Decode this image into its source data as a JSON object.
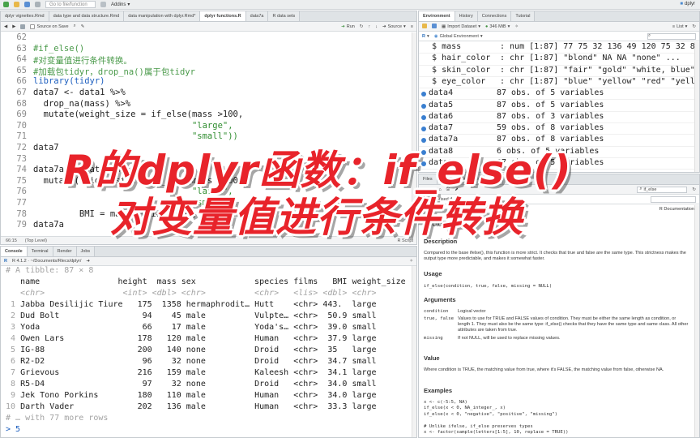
{
  "topbar": {
    "go_to_file": "Go to file/function",
    "addins": "Addins",
    "user": "dplyr"
  },
  "editor": {
    "tabs": [
      {
        "label": "dplyr vignettes.Rmd"
      },
      {
        "label": "data type and data structure.Rmd"
      },
      {
        "label": "data manipulation with dplyr.Rmd*"
      },
      {
        "label": "dplyr functions.R"
      },
      {
        "label": "data7a"
      },
      {
        "label": "R data sets"
      }
    ],
    "toolbar": {
      "source_on_save": "Source on Save",
      "run": "Run",
      "source": "Source"
    },
    "lines": [
      {
        "n": "62",
        "text": ""
      },
      {
        "n": "63",
        "text": "#if_else()",
        "cls": "comment"
      },
      {
        "n": "64",
        "text": "#对变量值进行条件转换。",
        "cls": "comment"
      },
      {
        "n": "65",
        "text": "#加载包tidyr，drop_na()属于包tidyr",
        "cls": "comment"
      },
      {
        "n": "66",
        "text": "library(tidyr)",
        "cls": "keyword"
      },
      {
        "n": "67",
        "text": "data7 <- data1 %>%"
      },
      {
        "n": "68",
        "text": "  drop_na(mass) %>%"
      },
      {
        "n": "69",
        "text": "  mutate(weight_size = if_else(mass >100,"
      },
      {
        "n": "70",
        "text": "                               \"large\",",
        "cls": "str"
      },
      {
        "n": "71",
        "text": "                               \"small\"))",
        "cls": "str"
      },
      {
        "n": "72",
        "text": "data7"
      },
      {
        "n": "73",
        "text": ""
      },
      {
        "n": "74",
        "text": "data7a <- data1 %>%"
      },
      {
        "n": "75",
        "text": "  mutate(weight_size = if_else(mass >100,"
      },
      {
        "n": "76",
        "text": "                               \"large\",",
        "cls": "str"
      },
      {
        "n": "77",
        "text": "                               \"small\"),",
        "cls": "str"
      },
      {
        "n": "78",
        "text": "         BMI = mass/(height/100)^2)"
      },
      {
        "n": "79",
        "text": "data7a"
      }
    ],
    "status_pos": "66:15",
    "status_level": "(Top Level)",
    "status_type": "R Script"
  },
  "console": {
    "tabs": [
      {
        "label": "Console"
      },
      {
        "label": "Terminal"
      },
      {
        "label": "Render"
      },
      {
        "label": "Jobs"
      }
    ],
    "path": "R 4.1.2 · ~/Documents/Rlecs/dplyr/",
    "tibble_header": "# A tibble: 87 × 8",
    "columns": "   name                height  mass sex            species films   BMI weight_size",
    "types": "   <chr>                <int> <dbl> <chr>          <chr>   <lis> <dbl> <chr>",
    "rows": [
      {
        "i": " 1",
        "text": "Jabba Desilijic Tiure   175  1358 hermaphrodit… Hutt    <chr> 443.  large"
      },
      {
        "i": " 2",
        "text": "Dud Bolt                 94    45 male          Vulpte… <chr>  50.9 small"
      },
      {
        "i": " 3",
        "text": "Yoda                     66    17 male          Yoda's… <chr>  39.0 small"
      },
      {
        "i": " 4",
        "text": "Owen Lars               178   120 male          Human   <chr>  37.9 large"
      },
      {
        "i": " 5",
        "text": "IG-88                   200   140 none          Droid   <chr>  35   large"
      },
      {
        "i": " 6",
        "text": "R2-D2                    96    32 none          Droid   <chr>  34.7 small"
      },
      {
        "i": " 7",
        "text": "Grievous                216   159 male          Kaleesh <chr>  34.1 large"
      },
      {
        "i": " 8",
        "text": "R5-D4                    97    32 none          Droid   <chr>  34.0 small"
      },
      {
        "i": " 9",
        "text": "Jek Tono Porkins        180   110 male          Human   <chr>  34.0 large"
      },
      {
        "i": "10",
        "text": "Darth Vader             202   136 male          Human   <chr>  33.3 large"
      }
    ],
    "more": "# … with 77 more rows",
    "prompt": "> 5"
  },
  "environment": {
    "tabs": [
      {
        "label": "Environment"
      },
      {
        "label": "History"
      },
      {
        "label": "Connections"
      },
      {
        "label": "Tutorial"
      }
    ],
    "import": "Import Dataset",
    "memory": "346 MiB",
    "list": "List",
    "scope": "Global Environment",
    "rows": [
      {
        "name": "  $ mass      ",
        "value": ": num [1:87] 77 75 32 136 49 120 75 32 84..."
      },
      {
        "name": "  $ hair_color",
        "value": ": chr [1:87] \"blond\" NA NA \"none\" ..."
      },
      {
        "name": "  $ skin_color",
        "value": ": chr [1:87] \"fair\" \"gold\" \"white, blue\"..."
      },
      {
        "name": "  $ eye_color ",
        "value": ": chr [1:87] \"blue\" \"yellow\" \"red\" \"yello..."
      },
      {
        "name": "data4",
        "value": "87 obs. of 5 variables",
        "dot": true
      },
      {
        "name": "data5",
        "value": "87 obs. of 5 variables",
        "dot": true
      },
      {
        "name": "data6",
        "value": "87 obs. of 3 variables",
        "dot": true
      },
      {
        "name": "data7",
        "value": "59 obs. of 8 variables",
        "dot": true
      },
      {
        "name": "data7a",
        "value": "87 obs. of 8 variables",
        "dot": true
      },
      {
        "name": "data8",
        "value": "6 obs. of 5 variables",
        "dot": true
      },
      {
        "name": "data9",
        "value": "87 obs. of 5 variables",
        "dot": true
      }
    ]
  },
  "help": {
    "tabs": [
      {
        "label": "Files"
      },
      {
        "label": "Plots"
      },
      {
        "label": "Packages"
      },
      {
        "label": "Help"
      },
      {
        "label": "Viewer"
      }
    ],
    "search": "if_else",
    "breadcrumb": "R: Vectorised if",
    "documentation": "R Documentation",
    "title": "Vectorised if",
    "description_h": "Description",
    "description": "Compared to the base ifelse(), this function is more strict. It checks that true and false are the same type. This strictness makes the output type more predictable, and makes it somewhat faster.",
    "usage_h": "Usage",
    "usage": "if_else(condition, true, false, missing = NULL)",
    "arguments_h": "Arguments",
    "args": [
      {
        "name": "condition",
        "desc": "Logical vector"
      },
      {
        "name": "true, false",
        "desc": "Values to use for TRUE and FALSE values of condition. They must be either the same length as condition, or length 1. They must also be the same type: if_else() checks that they have the same type and same class. All other attributes are taken from true."
      },
      {
        "name": "missing",
        "desc": "If not NULL, will be used to replace missing values."
      }
    ],
    "value_h": "Value",
    "value": "Where condition is TRUE, the matching value from true, where it's FALSE, the matching value from false, otherwise NA.",
    "examples_h": "Examples",
    "examples": "x <- c(-5:5, NA)\nif_else(x < 0, NA_integer_, x)\nif_else(x < 0, \"negative\", \"positive\", \"missing\")\n\n# Unlike ifelse, if_else preserves types\nx <- factor(sample(letters[1:5], 10, replace = TRUE))"
  },
  "overlay": {
    "line1": "R的dplyr函数：if_else()",
    "line2": "对变量值进行条件转换"
  },
  "colors": {
    "overlay_red": "#e8232a",
    "comment_green": "#4a9a4a",
    "keyword_blue": "#1d5fbf"
  }
}
